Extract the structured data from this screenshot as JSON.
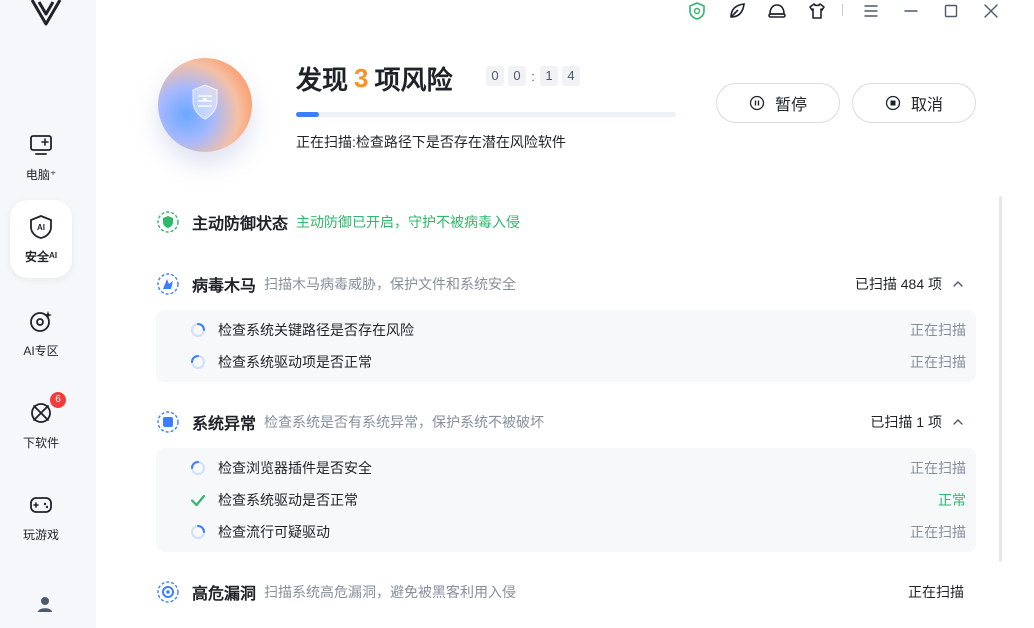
{
  "sidebar": {
    "items": [
      {
        "label": "电脑⁺",
        "icon": "computer-icon"
      },
      {
        "label": "安全ᴬᴵ",
        "icon": "ai-shield-icon"
      },
      {
        "label": "AI专区",
        "icon": "ai-zone-icon"
      },
      {
        "label": "下软件",
        "icon": "software-icon",
        "badge": "6"
      },
      {
        "label": "玩游戏",
        "icon": "gamepad-icon"
      }
    ],
    "active_index": 1
  },
  "titlebar": {
    "icons": [
      "shield-status-icon",
      "leaf-icon",
      "helmet-icon",
      "shirt-icon",
      "menu-icon",
      "minimize-icon",
      "maximize-icon",
      "close-icon"
    ]
  },
  "hero": {
    "title_prefix": "发现",
    "risk_count": "3",
    "title_suffix": "项风险",
    "timer": [
      "0",
      "0",
      ":",
      "1",
      "4"
    ],
    "progress": 0.06,
    "status_text": "正在扫描:检查路径下是否存在潜在风险软件",
    "pause_label": "暂停",
    "cancel_label": "取消"
  },
  "sections": {
    "defense": {
      "title": "主动防御状态",
      "desc": "主动防御已开启，守护不被病毒入侵"
    },
    "virus": {
      "title": "病毒木马",
      "desc": "扫描木马病毒威胁，保护文件和系统安全",
      "summary": "已扫描 484 项",
      "rows": [
        {
          "label": "检查系统关键路径是否存在风险",
          "status": "正在扫描"
        },
        {
          "label": "检查系统驱动项是否正常",
          "status": "正在扫描"
        }
      ]
    },
    "system": {
      "title": "系统异常",
      "desc": "检查系统是否有系统异常，保护系统不被破坏",
      "summary": "已扫描 1 项",
      "rows": [
        {
          "label": "检查浏览器插件是否安全",
          "status": "正在扫描"
        },
        {
          "label": "检查系统驱动是否正常",
          "status": "正常"
        },
        {
          "label": "检查流行可疑驱动",
          "status": "正在扫描"
        }
      ]
    },
    "vuln": {
      "title": "高危漏洞",
      "desc": "扫描系统高危漏洞，避免被黑客利用入侵",
      "summary": "正在扫描"
    }
  },
  "colors": {
    "accent": "#3d7eff",
    "risk": "#f5922a",
    "ok": "#2fb86a",
    "badge": "#f23c3c"
  }
}
